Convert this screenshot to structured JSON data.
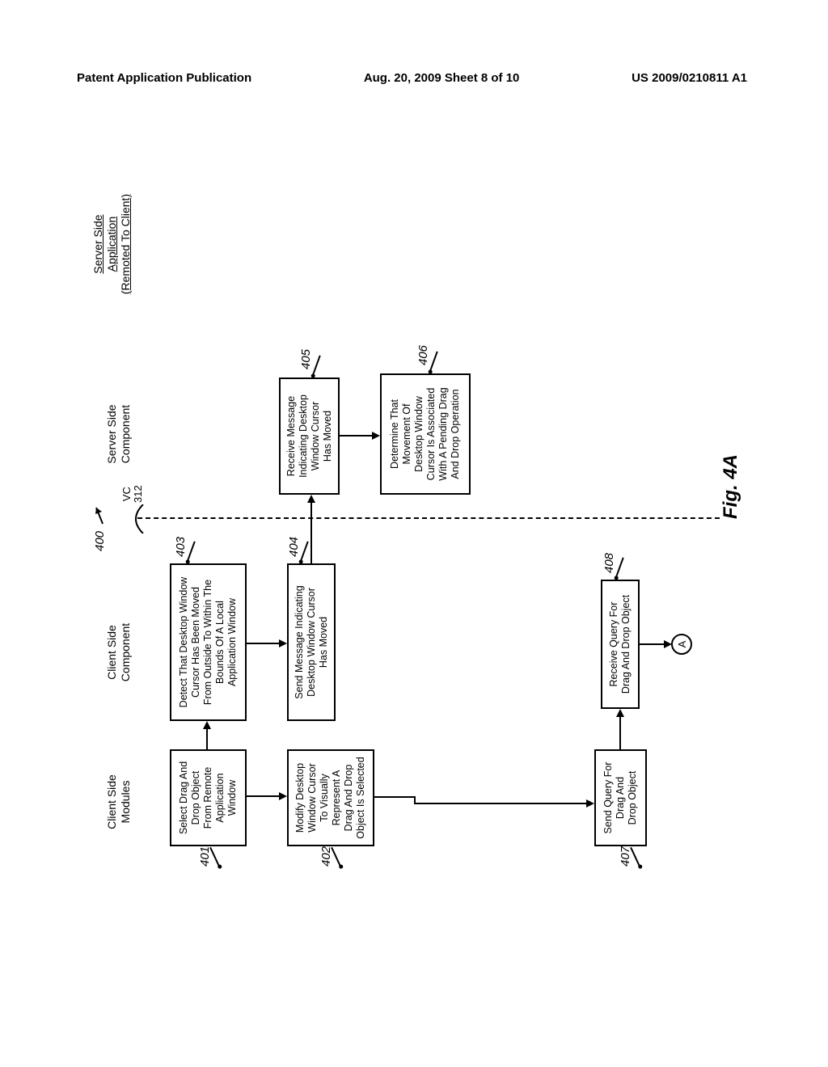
{
  "header": {
    "left": "Patent Application Publication",
    "center": "Aug. 20, 2009  Sheet 8 of 10",
    "right": "US 2009/0210811 A1"
  },
  "columns": {
    "clientModules": "Client Side\nModules",
    "clientComponent": "Client Side\nComponent",
    "serverComponent": "Server Side\nComponent",
    "serverApp": "Server Side\nApplication\n(Remoted To Client)"
  },
  "boxes": {
    "401": "Select Drag And\nDrop Object\nFrom Remote\nApplication\nWindow",
    "402": "Modify Desktop\nWindow Cursor\nTo Visually\nRepresent A\nDrag And Drop\nObject Is Selected",
    "403": "Detect That Desktop Window\nCursor Has Been Moved\nFrom Outside To Within The\nBounds Of A Local\nApplication Window",
    "404": "Send Message Indicating\nDesktop Window Cursor\nHas Moved",
    "405": "Receive Message\nIndicating Desktop\nWindow Cursor\nHas Moved",
    "406": "Determine That\nMovement Of\nDesktop Window\nCursor Is Associated\nWith A Pending Drag\nAnd Drop Operation",
    "407": "Send Query For\nDrag And\nDrop Object",
    "408": "Receive Query For\nDrag And Drop Object"
  },
  "refs": {
    "400": "400",
    "401": "401",
    "402": "402",
    "403": "403",
    "404": "404",
    "405": "405",
    "406": "406",
    "407": "407",
    "408": "408",
    "vc312": "VC\n312"
  },
  "connector": "A",
  "figLabel": "Fig. 4A"
}
